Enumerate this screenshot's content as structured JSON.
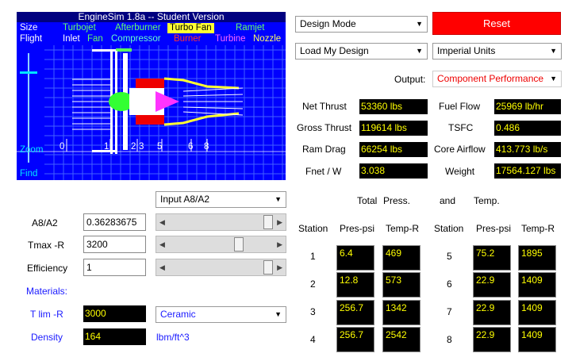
{
  "viewer": {
    "title": "EngineSim 1.8a  -- Student Version",
    "size_label": "Size",
    "flight_label": "Flight",
    "zoom_label": "Zoom",
    "find_label": "Find",
    "engine_types": [
      "Turbojet",
      "Afterburner",
      "Turbo Fan",
      "Ramjet"
    ],
    "components": [
      "Inlet",
      "Fan",
      "Compressor",
      "Burner",
      "Turbine",
      "Nozzle"
    ],
    "station_ticks": [
      "0",
      "1",
      "2",
      "3",
      "5",
      "6",
      "8"
    ]
  },
  "controls": {
    "design_mode": "Design Mode",
    "reset": "Reset",
    "load_design": "Load My Design",
    "units": "Imperial Units",
    "output_label": "Output:",
    "output_value": "Component Performance"
  },
  "performance": {
    "net_thrust_label": "Net Thrust",
    "net_thrust": "53360 lbs",
    "gross_thrust_label": "Gross Thrust",
    "gross_thrust": "119614 lbs",
    "ram_drag_label": "Ram Drag",
    "ram_drag": "66254 lbs",
    "fnet_w_label": "Fnet / W",
    "fnet_w": "3.038",
    "fuel_flow_label": "Fuel Flow",
    "fuel_flow": "25969 lb/hr",
    "tsfc_label": "TSFC",
    "tsfc": "0.486",
    "core_airflow_label": "Core Airflow",
    "core_airflow": "413.773 lb/s",
    "weight_label": "Weight",
    "weight": "17564.127 lbs"
  },
  "inputs": {
    "selector": "Input A8/A2",
    "a8a2_label": "A8/A2",
    "a8a2_value": "0.36283675",
    "tmax_label": "Tmax -R",
    "tmax_value": "3200",
    "efficiency_label": "Efficiency",
    "efficiency_value": "1",
    "materials_label": "Materials:",
    "tlim_label": "T lim -R",
    "tlim_value": "3000",
    "material": "Ceramic",
    "density_label": "Density",
    "density_value": "164",
    "density_unit": "lbm/ft^3"
  },
  "stations": {
    "header_total": "Total",
    "header_press": "Press.",
    "header_and": "and",
    "header_temp": "Temp.",
    "station_label": "Station",
    "pres_label": "Pres-psi",
    "temp_label": "Temp-R",
    "left": [
      {
        "station": "1",
        "pres": "6.4",
        "temp": "469"
      },
      {
        "station": "2",
        "pres": "12.8",
        "temp": "573"
      },
      {
        "station": "3",
        "pres": "256.7",
        "temp": "1342"
      },
      {
        "station": "4",
        "pres": "256.7",
        "temp": "2542"
      }
    ],
    "right": [
      {
        "station": "5",
        "pres": "75.2",
        "temp": "1895"
      },
      {
        "station": "6",
        "pres": "22.9",
        "temp": "1409"
      },
      {
        "station": "7",
        "pres": "22.9",
        "temp": "1409"
      },
      {
        "station": "8",
        "pres": "22.9",
        "temp": "1409"
      }
    ]
  },
  "colors": {
    "viewer_bg": "#0000ff",
    "value_bg": "#000000",
    "value_text": "#ffff00",
    "reset_bg": "#ff0000",
    "output_text": "#ff0000",
    "materials_text": "#1a1aff"
  }
}
